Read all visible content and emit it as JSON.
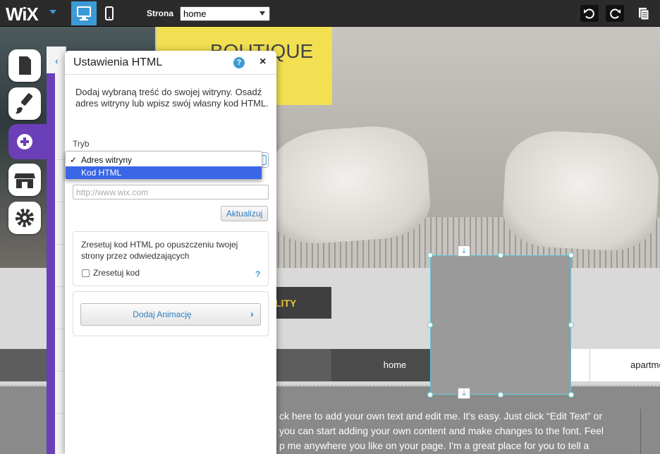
{
  "topbar": {
    "logo": "WiX",
    "page_label": "Strona",
    "page_value": "home"
  },
  "site": {
    "boutique_text": "BOUTIQUE\nHOTEL",
    "quality_text": "LITY",
    "nav_home": "home",
    "nav_apartments": "apartments",
    "content_lines": [
      "ck here to add your own text and edit me. It's easy. Just click “Edit Text” or",
      " you can start adding your own content and make changes to the font. Feel",
      "p me anywhere you like on your page. I'm a great place for you to tell a"
    ]
  },
  "dialog": {
    "title": "Ustawienia HTML",
    "help": "?",
    "close": "×",
    "description": "Dodaj wybraną treść do swojej witryny. Osadź adres witryny lub wpisz swój własny kod HTML.",
    "mode_label": "Tryb",
    "dropdown": {
      "check": "✓",
      "options": [
        "Adres witryny",
        "Kod HTML"
      ]
    },
    "url_placeholder": "http://www.wix.com",
    "update_button": "Aktualizuj",
    "reset_text": "Zresetuj kod HTML po opuszczeniu twojej strony przez odwiedzających",
    "reset_label": "Zresetuj kod",
    "reset_help": "?",
    "animation_button": "Dodaj Animację",
    "animation_chevron": "›"
  },
  "colors": {
    "accent": "#3c9bd6",
    "purple": "#6a3fb8",
    "selected_highlight": "#3a66e6"
  }
}
